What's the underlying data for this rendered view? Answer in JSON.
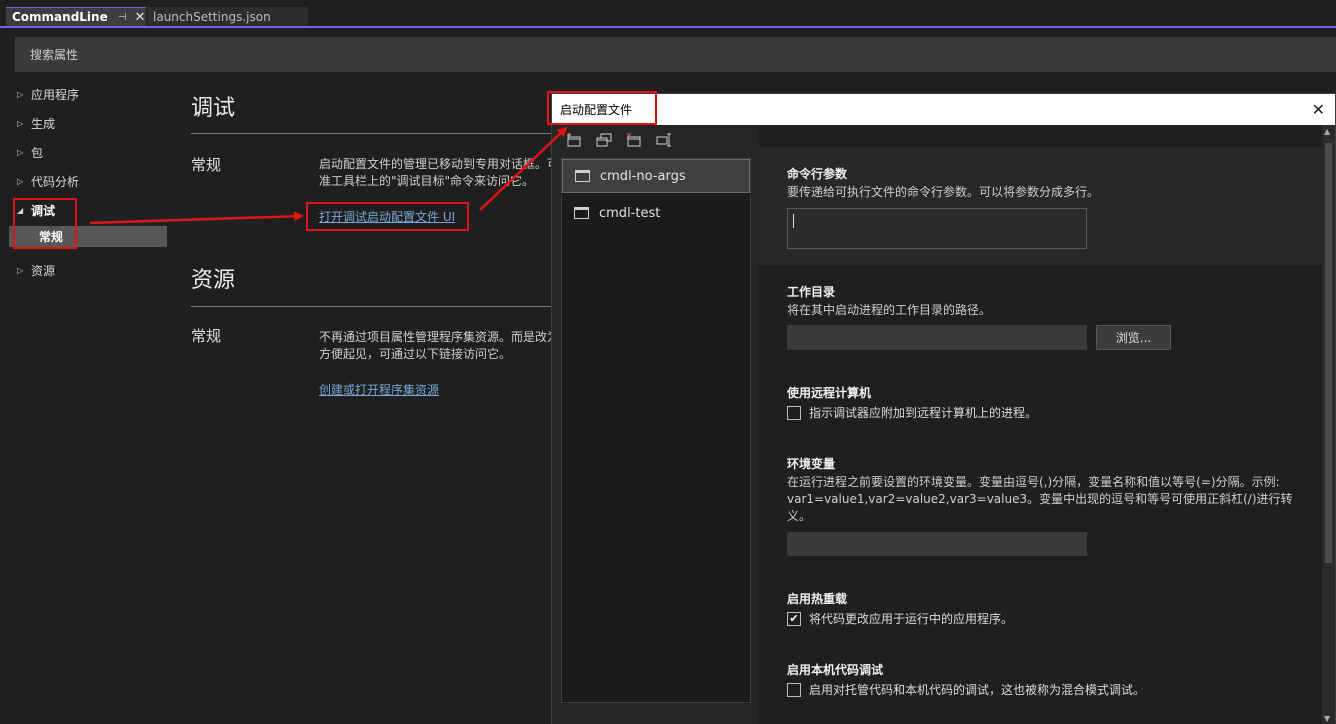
{
  "tabs": {
    "active": "CommandLine",
    "inactive": "launchSettings.json",
    "pin_glyph": "⊣",
    "close_glyph": "✕"
  },
  "search": {
    "placeholder": "搜索属性"
  },
  "nav": {
    "items": [
      {
        "label": "应用程序"
      },
      {
        "label": "生成"
      },
      {
        "label": "包"
      },
      {
        "label": "代码分析"
      },
      {
        "label": "调试"
      },
      {
        "label": "资源"
      }
    ],
    "sub_selected": "常规"
  },
  "main": {
    "debug": {
      "heading": "调试",
      "subheading": "常规",
      "desc_line1": "启动配置文件的管理已移动到专用对话框。可",
      "desc_line2": "准工具栏上的\"调试目标\"命令来访问它。",
      "link": "打开调试启动配置文件 UI"
    },
    "resources": {
      "heading": "资源",
      "subheading": "常规",
      "desc_line1": "不再通过项目属性管理程序集资源。而是改为",
      "desc_line2": "方便起见，可通过以下链接访问它。",
      "link": "创建或打开程序集资源"
    }
  },
  "dialog": {
    "title": "启动配置文件",
    "close_glyph": "✕",
    "toolbar_icons": [
      "new-profile-icon",
      "copy-profile-icon",
      "delete-profile-icon",
      "rename-profile-icon"
    ],
    "profiles": [
      "cmdl-no-args",
      "cmdl-test"
    ],
    "fields": {
      "args_title": "命令行参数",
      "args_desc": "要传递给可执行文件的命令行参数。可以将参数分成多行。",
      "args_value": "",
      "workdir_title": "工作目录",
      "workdir_desc": "将在其中启动进程的工作目录的路径。",
      "workdir_value": "",
      "browse_label": "浏览...",
      "remote_title": "使用远程计算机",
      "remote_check": "指示调试器应附加到远程计算机上的进程。",
      "remote_checked": false,
      "env_title": "环境变量",
      "env_desc_line1": "在运行进程之前要设置的环境变量。变量由逗号(,)分隔，变量名称和值以等号(=)分隔。示例:",
      "env_desc_line2": "var1=value1,var2=value2,var3=value3。变量中出现的逗号和等号可使用正斜杠(/)进行转",
      "env_desc_line3": "义。",
      "env_value": "",
      "hotreload_title": "启用热重载",
      "hotreload_check": "将代码更改应用于运行中的应用程序。",
      "hotreload_checked": true,
      "native_title": "启用本机代码调试",
      "native_check": "启用对托管代码和本机代码的调试，这也被称为混合模式调试。",
      "native_checked": false
    }
  },
  "colors": {
    "accent": "#7160e8",
    "annotation_red": "#e01414",
    "link": "#7aa7d8"
  }
}
